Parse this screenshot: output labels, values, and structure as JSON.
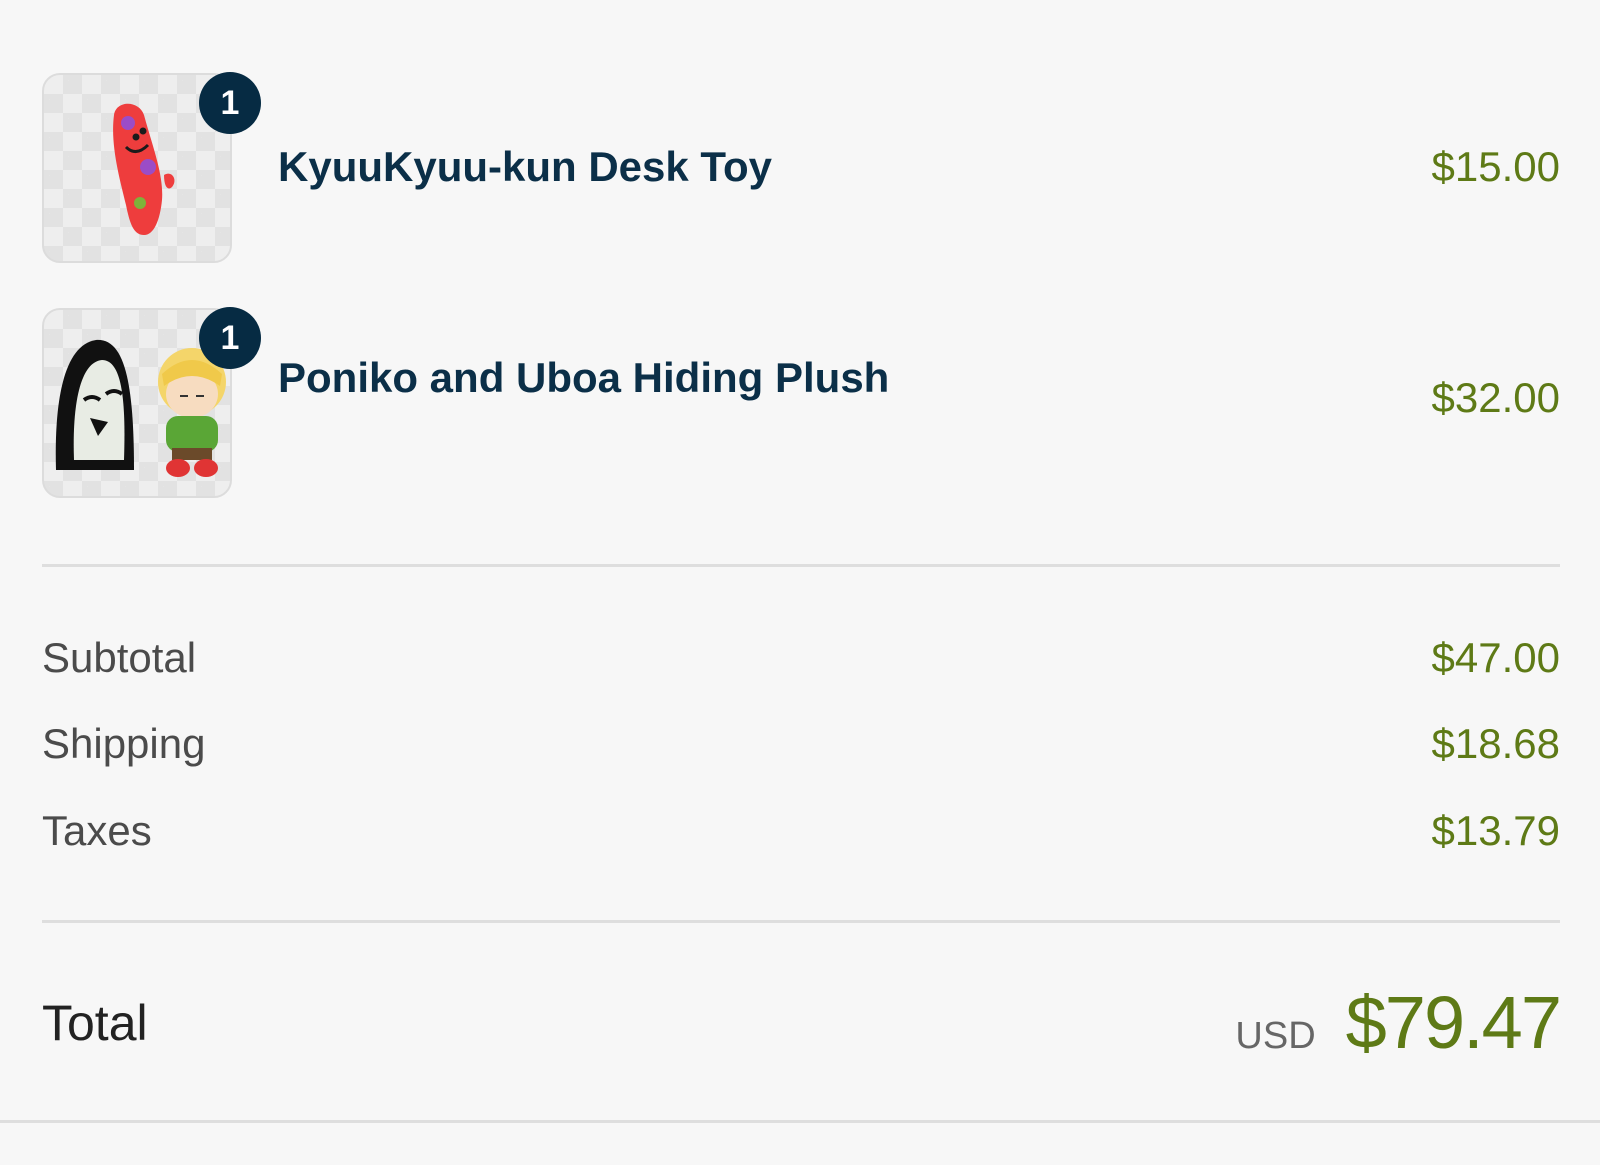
{
  "items": [
    {
      "name": "KyuuKyuu-kun Desk Toy",
      "price": "$15.00",
      "quantity": "1",
      "image_icon": "red-desk-toy-image"
    },
    {
      "name": "Poniko and Uboa Hiding Plush",
      "price": "$32.00",
      "quantity": "1",
      "image_icon": "plush-toy-image"
    }
  ],
  "summary": {
    "subtotal_label": "Subtotal",
    "subtotal_value": "$47.00",
    "shipping_label": "Shipping",
    "shipping_value": "$18.68",
    "taxes_label": "Taxes",
    "taxes_value": "$13.79",
    "total_label": "Total",
    "currency": "USD",
    "total_value": "$79.47"
  },
  "colors": {
    "price_green": "#5e7a16",
    "name_navy": "#0b2f48",
    "badge_navy": "#062b43",
    "background": "#f7f7f7"
  }
}
